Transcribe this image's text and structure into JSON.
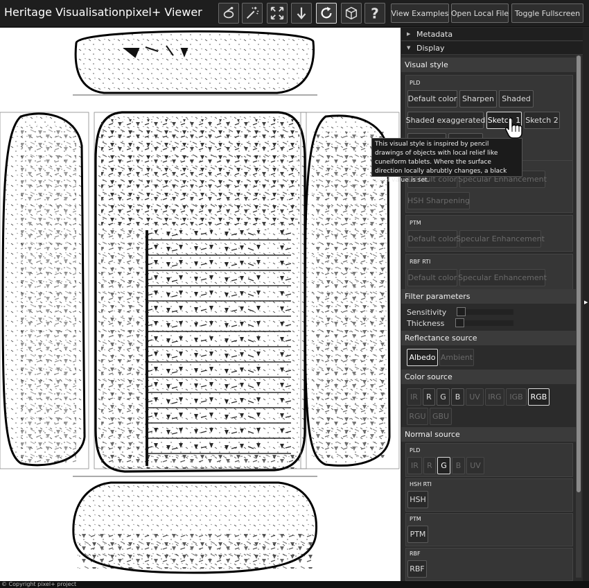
{
  "header": {
    "app_title": "Heritage Visualisation",
    "viewer_title": "pixel+ Viewer",
    "tools": [
      "light-probe-icon",
      "magic-wand-icon",
      "fit-screen-icon",
      "download-icon",
      "reset-rotate-icon",
      "cube-icon",
      "help-icon"
    ],
    "view_examples_label": "View Examples",
    "open_local_file_label": "Open Local File",
    "toggle_fullscreen_label": "Toggle Fullscreen"
  },
  "panel": {
    "metadata_label": "Metadata",
    "display_label": "Display",
    "visual_style": {
      "title": "Visual style",
      "pld": {
        "label": "PLD",
        "buttons": [
          "Default color",
          "Sharpen",
          "Shaded",
          "Shaded exaggerated",
          "Sketch 1",
          "Sketch 2"
        ],
        "selected": "Sketch 1"
      },
      "hsh": {
        "buttons": [
          "Default color",
          "Specular Enhancement",
          "HSH Sharpening"
        ]
      },
      "ptm": {
        "label": "PTM",
        "buttons": [
          "Default color",
          "Specular Enhancement"
        ]
      },
      "rbf": {
        "label": "RBF RTI",
        "buttons": [
          "Default color",
          "Specular Enhancement"
        ]
      }
    },
    "filter_parameters": {
      "title": "Filter parameters",
      "sensitivity_label": "Sensitivity",
      "thickness_label": "Thickness",
      "sensitivity": 0,
      "thickness": 0
    },
    "reflectance_source": {
      "title": "Reflectance source",
      "albedo_label": "Albedo",
      "ambient_label": "Ambient",
      "selected": "Albedo"
    },
    "color_source": {
      "title": "Color source",
      "buttons": [
        "IR",
        "R",
        "G",
        "B",
        "UV",
        "IRG",
        "IGB",
        "RGB",
        "RGU",
        "GBU"
      ],
      "selected": "RGB"
    },
    "normal_source": {
      "title": "Normal source",
      "pld_label": "PLD",
      "pld_buttons": [
        "IR",
        "R",
        "G",
        "B",
        "UV"
      ],
      "pld_selected": "G",
      "hsh_label": "HSH RTI",
      "hsh_button": "HSH",
      "ptm_label": "PTM",
      "ptm_button": "PTM",
      "rbf_label": "RBF",
      "rbf_button": "RBF"
    }
  },
  "tooltip": "This visual style is inspired by pencil drawings of objects with local relief like cuneiform tablets. Where the surface direction locally abrubtly changes, a black pixel value is set.",
  "footer": "© Copyright pixel+ project",
  "colors": {
    "top_bar": "#1e1e1e",
    "panel_bg": "#2b2b2b",
    "section_bg": "#3b3b3b",
    "viewer_bg": "#ffffff"
  }
}
